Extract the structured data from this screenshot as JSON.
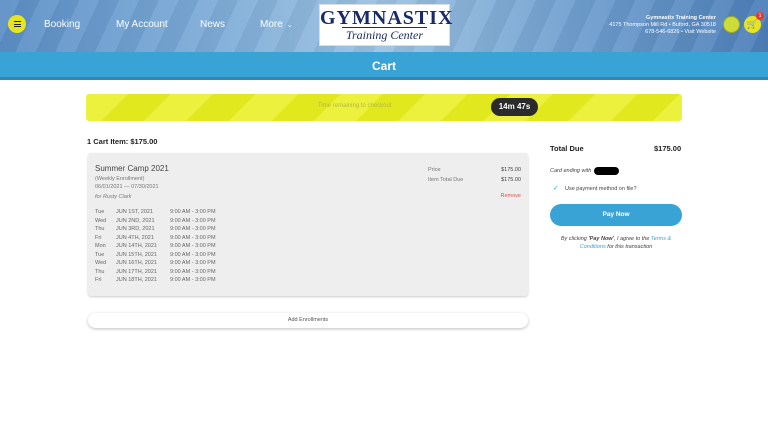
{
  "header": {
    "nav": {
      "booking": "Booking",
      "account": "My Account",
      "news": "News",
      "more": "More"
    },
    "logo": {
      "line1": "GYMNASTIX",
      "line2": "Training Center"
    },
    "gym": {
      "name": "Gymnastix Training Center",
      "address": "4175 Thompson Mill Rd • Buford, GA 30518",
      "contact": "678-546-6826 • Visit Website"
    },
    "cart_badge": "1"
  },
  "page_title": "Cart",
  "timer": {
    "label": "Time remaining to checkout",
    "value": "14m 47s"
  },
  "cart": {
    "count_label": "1 Cart Item: $175.00",
    "item": {
      "title": "Summer Camp 2021",
      "type": "(Weekly Enrollment)",
      "dates": "06/01/2021 — 07/30/2021",
      "participant": "for Rusty Clark",
      "price_label": "Price",
      "price": "$175.00",
      "total_label": "Item Total Due",
      "total": "$175.00",
      "remove": "Remove",
      "schedule": [
        {
          "day": "Tue",
          "date": "JUN 1ST, 2021",
          "time": "9:00 AM - 3:00 PM"
        },
        {
          "day": "Wed",
          "date": "JUN 2ND, 2021",
          "time": "9:00 AM - 3:00 PM"
        },
        {
          "day": "Thu",
          "date": "JUN 3RD, 2021",
          "time": "9:00 AM - 3:00 PM"
        },
        {
          "day": "Fri",
          "date": "JUN 4TH, 2021",
          "time": "9:00 AM - 3:00 PM"
        },
        {
          "day": "Mon",
          "date": "JUN 14TH, 2021",
          "time": "9:00 AM - 3:00 PM"
        },
        {
          "day": "Tue",
          "date": "JUN 15TH, 2021",
          "time": "9:00 AM - 3:00 PM"
        },
        {
          "day": "Wed",
          "date": "JUN 16TH, 2021",
          "time": "9:00 AM - 3:00 PM"
        },
        {
          "day": "Thu",
          "date": "JUN 17TH, 2021",
          "time": "9:00 AM - 3:00 PM"
        },
        {
          "day": "Fri",
          "date": "JUN 18TH, 2021",
          "time": "9:00 AM - 3:00 PM"
        }
      ]
    },
    "add_enrollments": "Add Enrollments"
  },
  "summary": {
    "total_label": "Total Due",
    "total": "$175.00",
    "card_ending": "Card ending with",
    "use_payment": "Use payment method on file?",
    "pay_button": "Pay Now",
    "terms_prefix": "By clicking ",
    "terms_bold": "'Pay Now'",
    "terms_mid": ", I agree to the ",
    "terms_link": "Terms & Conditions",
    "terms_suffix": " for this transaction"
  },
  "colors": {
    "accent": "#3aa3d5",
    "banner": "#e8ef1f",
    "remove": "#e05353"
  }
}
